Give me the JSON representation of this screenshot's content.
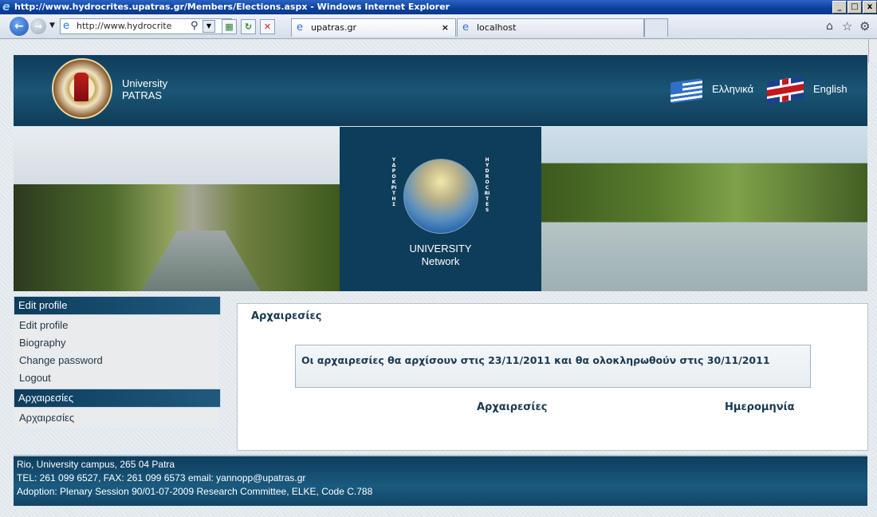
{
  "browser": {
    "title": "http://www.hydrocrites.upatras.gr/Members/Elections.aspx - Windows Internet Explorer",
    "address_url": "http://www.hydrocrites.",
    "tabs": [
      {
        "label": "upatras.gr",
        "close": "×"
      },
      {
        "label": "localhost"
      }
    ]
  },
  "header": {
    "university_line1": "University",
    "university_line2": "PATRAS",
    "lang_greek": "Ελληνικά",
    "lang_english": "English"
  },
  "banner": {
    "logo_left_text": "ΥΔΡΟΚΡΙΤΗΣ",
    "logo_right_text": "HYDROCRITES",
    "caption_line1": "UNIVERSITY",
    "caption_line2": "Network"
  },
  "sidebar": {
    "section1_title": "Edit profile",
    "section1_items": [
      "Edit profile",
      "Biography",
      "Change password",
      "Logout"
    ],
    "section2_title": "Αρχαιρεσίες",
    "section2_items": [
      "Αρχαιρεσίες"
    ]
  },
  "content": {
    "title": "Αρχαιρεσίες",
    "notice": "Οι αρχαιρεσίες θα αρχίσουν στις 23/11/2011 και θα ολοκληρωθούν στις 30/11/2011",
    "columns": [
      "Αρχαιρεσίες",
      "Ημερομηνία"
    ]
  },
  "footer": {
    "line1": "Rio, University campus, 265 04 Patra",
    "line2": "TEL: 261 099 6527, FAX: 261 099 6573 email:  yannopp@upatras.gr",
    "line3": "Adoption: Plenary Session 90/01-07-2009 Research Committee, ELKE, Code C.788"
  },
  "colors": {
    "header_dark": "#0f3c58",
    "accent_text": "#1a3a52",
    "titlebar": "#0b3f9c"
  }
}
